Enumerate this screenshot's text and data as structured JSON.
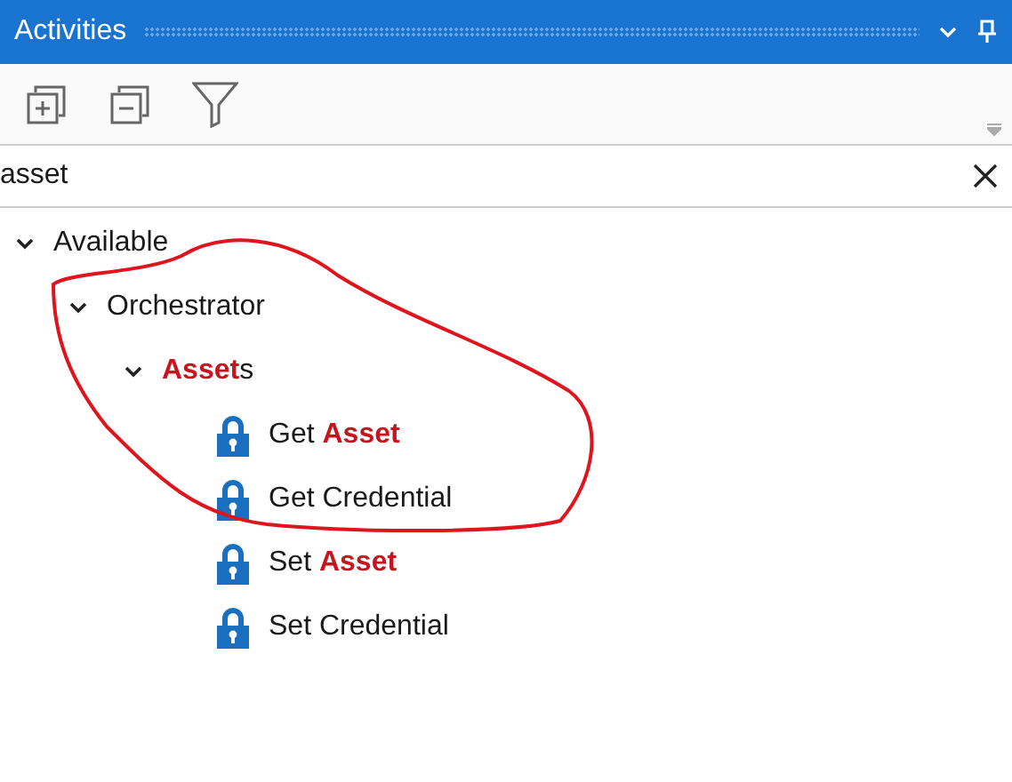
{
  "window": {
    "title": "Activities"
  },
  "search": {
    "value": "asset"
  },
  "tree": [
    {
      "label": "Available",
      "kind": "folder",
      "expanded": true,
      "children": [
        {
          "label": "Orchestrator",
          "kind": "folder",
          "expanded": true,
          "children": [
            {
              "label": "**Asset**s",
              "kind": "folder",
              "expanded": true,
              "children": [
                {
                  "label": "Get **Asset**",
                  "kind": "activity"
                },
                {
                  "label": "Get Credential",
                  "kind": "activity"
                },
                {
                  "label": "Set **Asset**",
                  "kind": "activity"
                },
                {
                  "label": "Set Credential",
                  "kind": "activity"
                }
              ]
            }
          ]
        }
      ]
    }
  ]
}
